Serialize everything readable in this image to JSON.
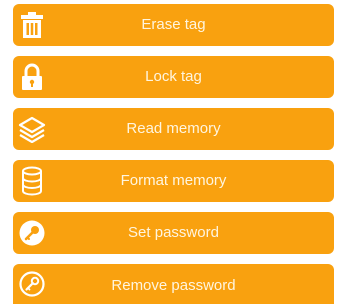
{
  "theme": {
    "button_color": "#f9a10f",
    "text_color": "#fff5df",
    "icon_color": "#ffffff"
  },
  "menu": {
    "items": [
      {
        "label": "Erase tag",
        "icon": "trash-icon"
      },
      {
        "label": "Lock tag",
        "icon": "padlock-icon"
      },
      {
        "label": "Read memory",
        "icon": "layers-icon"
      },
      {
        "label": "Format memory",
        "icon": "database-icon"
      },
      {
        "label": "Set password",
        "icon": "key-icon"
      },
      {
        "label": "Remove password",
        "icon": "key-remove-icon"
      }
    ]
  }
}
